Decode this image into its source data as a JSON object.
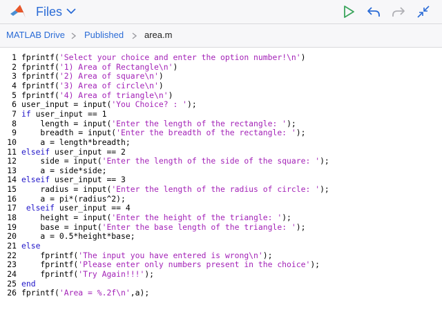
{
  "header": {
    "title": "Files",
    "logo_icon": "matlab-logo-icon",
    "buttons": [
      "run-icon",
      "undo-icon",
      "redo-icon",
      "collapse-icon"
    ],
    "accent_color": "#2a6bd6",
    "run_color": "#3ba55c"
  },
  "breadcrumb": {
    "items": [
      "MATLAB Drive",
      "Published",
      "area.m"
    ]
  },
  "editor": {
    "keyword_color": "#1f14c8",
    "string_color": "#a322b7",
    "lines": [
      {
        "n": "1",
        "code": [
          [
            "p",
            "fprintf("
          ],
          [
            "s",
            "'Select your choice and enter the option number!\\n'"
          ],
          [
            "p",
            ")"
          ]
        ]
      },
      {
        "n": "2",
        "code": [
          [
            "p",
            "fprintf("
          ],
          [
            "s",
            "'1) Area of Rectangle\\n'"
          ],
          [
            "p",
            ")"
          ]
        ]
      },
      {
        "n": "3",
        "code": [
          [
            "p",
            "fprintf("
          ],
          [
            "s",
            "'2) Area of square\\n'"
          ],
          [
            "p",
            ")"
          ]
        ]
      },
      {
        "n": "4",
        "code": [
          [
            "p",
            "fprintf("
          ],
          [
            "s",
            "'3) Area of circle\\n'"
          ],
          [
            "p",
            ")"
          ]
        ]
      },
      {
        "n": "5",
        "code": [
          [
            "p",
            "fprintf("
          ],
          [
            "s",
            "'4) Area of triangle\\n'"
          ],
          [
            "p",
            ")"
          ]
        ]
      },
      {
        "n": "6",
        "code": [
          [
            "p",
            "user_input = input("
          ],
          [
            "s",
            "'You Choice? : '"
          ],
          [
            "p",
            ");"
          ]
        ]
      },
      {
        "n": "7",
        "code": [
          [
            "k",
            "if"
          ],
          [
            "p",
            " user_input == 1"
          ]
        ]
      },
      {
        "n": "8",
        "code": [
          [
            "p",
            "    length = input("
          ],
          [
            "s",
            "'Enter the length of the rectangle: '"
          ],
          [
            "p",
            ");"
          ]
        ]
      },
      {
        "n": "9",
        "code": [
          [
            "p",
            "    breadth = input("
          ],
          [
            "s",
            "'Enter the breadth of the rectangle: '"
          ],
          [
            "p",
            ");"
          ]
        ]
      },
      {
        "n": "10",
        "code": [
          [
            "p",
            "    a = length*breadth;"
          ]
        ]
      },
      {
        "n": "11",
        "code": [
          [
            "k",
            "elseif"
          ],
          [
            "p",
            " user_input == 2"
          ]
        ]
      },
      {
        "n": "12",
        "code": [
          [
            "p",
            "    side = input("
          ],
          [
            "s",
            "'Enter the length of the side of the square: '"
          ],
          [
            "p",
            ");"
          ]
        ]
      },
      {
        "n": "13",
        "code": [
          [
            "p",
            "    a = side*side;"
          ]
        ]
      },
      {
        "n": "14",
        "code": [
          [
            "k",
            "elseif"
          ],
          [
            "p",
            " user_input == 3"
          ]
        ]
      },
      {
        "n": "15",
        "code": [
          [
            "p",
            "    radius = input("
          ],
          [
            "s",
            "'Enter the length of the radius of circle: '"
          ],
          [
            "p",
            ");"
          ]
        ]
      },
      {
        "n": "16",
        "code": [
          [
            "p",
            "    a = pi*(radius^2);"
          ]
        ]
      },
      {
        "n": "17",
        "code": [
          [
            "p",
            " "
          ],
          [
            "k",
            "elseif"
          ],
          [
            "p",
            " user_input == 4"
          ]
        ]
      },
      {
        "n": "18",
        "code": [
          [
            "p",
            "    height = input("
          ],
          [
            "s",
            "'Enter the height of the triangle: '"
          ],
          [
            "p",
            ");"
          ]
        ]
      },
      {
        "n": "19",
        "code": [
          [
            "p",
            "    base = input("
          ],
          [
            "s",
            "'Enter the base length of the triangle: '"
          ],
          [
            "p",
            ");"
          ]
        ]
      },
      {
        "n": "20",
        "code": [
          [
            "p",
            "    a = 0.5*height*base;"
          ]
        ]
      },
      {
        "n": "21",
        "code": [
          [
            "k",
            "else"
          ]
        ]
      },
      {
        "n": "22",
        "code": [
          [
            "p",
            "    fprintf("
          ],
          [
            "s",
            "'The input you have entered is wrong\\n'"
          ],
          [
            "p",
            ");"
          ]
        ]
      },
      {
        "n": "23",
        "code": [
          [
            "p",
            "    fprintf("
          ],
          [
            "s",
            "'Please enter only numbers present in the choice'"
          ],
          [
            "p",
            ");"
          ]
        ]
      },
      {
        "n": "24",
        "code": [
          [
            "p",
            "    fprintf("
          ],
          [
            "s",
            "'Try Again!!!'"
          ],
          [
            "p",
            ");"
          ]
        ]
      },
      {
        "n": "25",
        "code": [
          [
            "k",
            "end"
          ]
        ]
      },
      {
        "n": "26",
        "code": [
          [
            "p",
            "fprintf("
          ],
          [
            "s",
            "'Area = %.2f\\n'"
          ],
          [
            "p",
            ",a);"
          ]
        ]
      }
    ]
  }
}
